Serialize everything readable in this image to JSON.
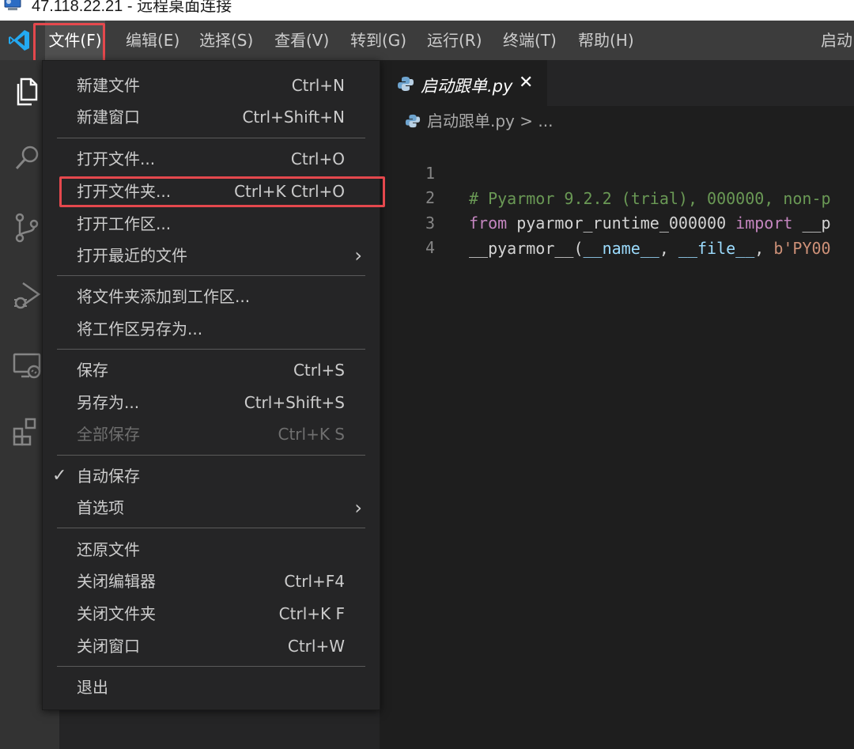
{
  "remote_window": {
    "title": "47.118.22.21 - 远程桌面连接",
    "icon": "remote-desktop-icon"
  },
  "menubar": {
    "items": [
      {
        "label": "文件(F)",
        "active": true
      },
      {
        "label": "编辑(E)"
      },
      {
        "label": "选择(S)"
      },
      {
        "label": "查看(V)"
      },
      {
        "label": "转到(G)"
      },
      {
        "label": "运行(R)"
      },
      {
        "label": "终端(T)"
      },
      {
        "label": "帮助(H)"
      }
    ],
    "title_right": "启动"
  },
  "activity_bar": {
    "icons": [
      "explorer-icon",
      "search-icon",
      "source-control-icon",
      "run-debug-icon",
      "remote-explorer-icon",
      "extensions-icon"
    ]
  },
  "editor": {
    "tab": {
      "label": "启动跟单.py",
      "icon": "python-icon",
      "close": "✕"
    },
    "breadcrumb": {
      "file": "启动跟单.py",
      "rest": "> ..."
    },
    "lines": [
      {
        "num": "1",
        "comment": "# Pyarmor 9.2.2 (trial), 000000, non-p"
      },
      {
        "num": "2",
        "kw1": "from",
        "mod": " pyarmor_runtime_000000 ",
        "kw2": "import",
        "rest": " __p"
      },
      {
        "num": "3",
        "a": "__pyarmor__(",
        "b": "__name__",
        "c": ", ",
        "d": "__file__",
        "e": ", ",
        "f": "b'PY00"
      },
      {
        "num": "4"
      }
    ]
  },
  "file_menu": {
    "items": [
      {
        "label": "新建文件",
        "shortcut": "Ctrl+N"
      },
      {
        "label": "新建窗口",
        "shortcut": "Ctrl+Shift+N"
      },
      {
        "label": "打开文件...",
        "shortcut": "Ctrl+O"
      },
      {
        "label": "打开文件夹...",
        "shortcut": "Ctrl+K Ctrl+O",
        "highlighted": true
      },
      {
        "label": "打开工作区..."
      },
      {
        "label": "打开最近的文件",
        "submenu": "›"
      },
      {
        "label": "将文件夹添加到工作区..."
      },
      {
        "label": "将工作区另存为..."
      },
      {
        "label": "保存",
        "shortcut": "Ctrl+S"
      },
      {
        "label": "另存为...",
        "shortcut": "Ctrl+Shift+S"
      },
      {
        "label": "全部保存",
        "shortcut": "Ctrl+K S",
        "disabled": true
      },
      {
        "label": "自动保存",
        "checked": "✓"
      },
      {
        "label": "首选项",
        "submenu": "›"
      },
      {
        "label": "还原文件"
      },
      {
        "label": "关闭编辑器",
        "shortcut": "Ctrl+F4"
      },
      {
        "label": "关闭文件夹",
        "shortcut": "Ctrl+K F"
      },
      {
        "label": "关闭窗口",
        "shortcut": "Ctrl+W"
      },
      {
        "label": "退出"
      }
    ]
  },
  "colors": {
    "highlight": "#e5484d",
    "menubar_bg": "#3c3c3c",
    "menu_bg": "#252526",
    "editor_bg": "#1e1e1e",
    "vscode_blue": "#23a9f2"
  }
}
